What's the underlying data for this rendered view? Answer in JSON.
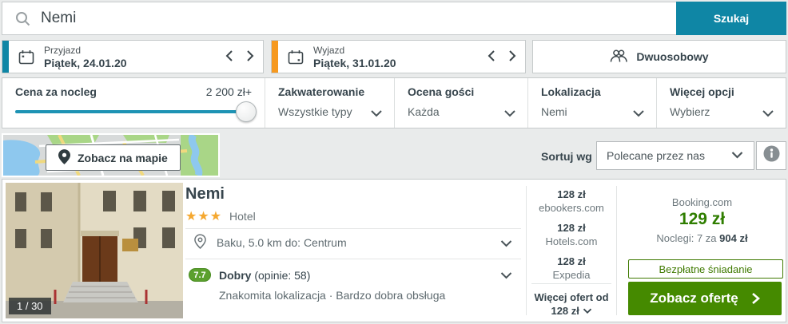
{
  "search": {
    "query": "Nemi",
    "button_label": "Szukaj"
  },
  "dates": {
    "checkin": {
      "label": "Przyjazd",
      "value": "Piątek, 24.01.20"
    },
    "checkout": {
      "label": "Wyjazd",
      "value": "Piątek, 31.01.20"
    },
    "guests_label": "Dwuosobowy"
  },
  "filters": {
    "price": {
      "label": "Cena za nocleg",
      "max_value": "2 200 zł+"
    },
    "accommodation": {
      "label": "Zakwaterowanie",
      "value": "Wszystkie typy"
    },
    "guest_rating": {
      "label": "Ocena gości",
      "value": "Każda"
    },
    "location": {
      "label": "Lokalizacja",
      "value": "Nemi"
    },
    "more_options": {
      "label": "Więcej opcji",
      "value": "Wybierz"
    }
  },
  "map_bar": {
    "map_button_label": "Zobacz na mapie",
    "sort_label": "Sortuj wg",
    "sort_value": "Polecane przez nas"
  },
  "hotel": {
    "image_counter": "1 / 30",
    "name": "Nemi",
    "stars": "★★★",
    "category": "Hotel",
    "location_text": "Baku, 5.0 km do: Centrum",
    "rating": {
      "score": "7.7",
      "word": "Dobry",
      "reviews": "(opinie: 58)",
      "summary": "Znakomita lokalizacja · Bardzo dobra obsługa"
    },
    "offers": [
      {
        "price": "128 zł",
        "site": "ebookers.com"
      },
      {
        "price": "128 zł",
        "site": "Hotels.com"
      },
      {
        "price": "128 zł",
        "site": "Expedia"
      }
    ],
    "more_offers": {
      "label": "Więcej ofert od",
      "price": "128 zł"
    },
    "top_deal": {
      "site": "Booking.com",
      "price": "129 zł",
      "nights_label": "Noclegi: 7 za",
      "nights_total": "904 zł",
      "perk": "Bezpłatne śniadanie",
      "cta_label": "Zobacz ofertę"
    }
  },
  "colors": {
    "accent_teal": "#0f86a5",
    "accent_orange": "#f6991f",
    "price_green": "#2f7e00",
    "cta_green": "#458a00",
    "rating_badge_green": "#5ba02e",
    "star_orange": "#f5a830"
  }
}
